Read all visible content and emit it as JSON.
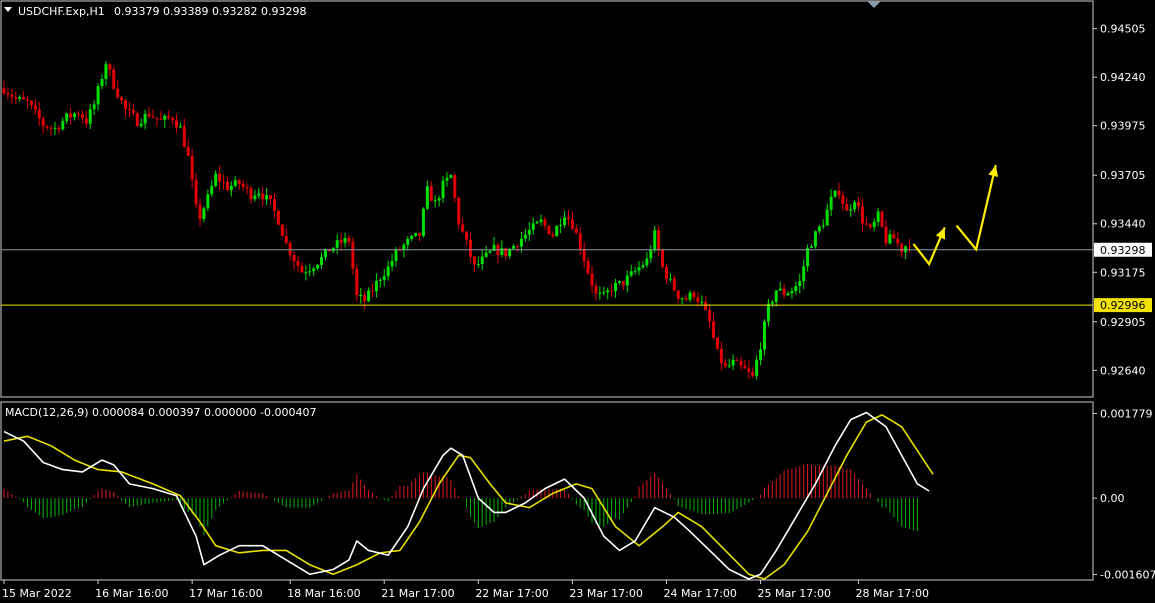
{
  "chart_data": [
    {
      "type": "candlestick",
      "symbol_header": "USDCHF.Exp,H1",
      "ohlc_header": "0.93379 0.93389 0.93282 0.93298",
      "price_ticks": [
        "0.94505",
        "0.94240",
        "0.93975",
        "0.93705",
        "0.93440",
        "0.93175",
        "0.92905",
        "0.92640"
      ],
      "ylim": [
        0.925,
        0.9465
      ],
      "current_price": "0.93298",
      "level_line": "0.92996",
      "colors": {
        "bull": "#00e000",
        "bear": "#e00000",
        "level": "#f2e400",
        "current_line": "#8c9aa8",
        "arrow": "#ffee00"
      },
      "x_ticks": [
        "15 Mar 2022",
        "16 Mar 16:00",
        "17 Mar 16:00",
        "18 Mar 16:00",
        "21 Mar 17:00",
        "22 Mar 17:00",
        "23 Mar 17:00",
        "24 Mar 17:00",
        "25 Mar 17:00",
        "28 Mar 17:00"
      ],
      "close_path": [
        [
          0,
          0.9418
        ],
        [
          3,
          0.9412
        ],
        [
          6,
          0.941
        ],
        [
          10,
          0.9398
        ],
        [
          13,
          0.9396
        ],
        [
          16,
          0.9402
        ],
        [
          19,
          0.9405
        ],
        [
          21,
          0.94
        ],
        [
          23,
          0.9409
        ],
        [
          26,
          0.9432
        ],
        [
          28,
          0.942
        ],
        [
          31,
          0.9406
        ],
        [
          34,
          0.94
        ],
        [
          37,
          0.9404
        ],
        [
          40,
          0.94
        ],
        [
          43,
          0.9402
        ],
        [
          45,
          0.9396
        ],
        [
          47,
          0.938
        ],
        [
          49,
          0.9352
        ],
        [
          50,
          0.9348
        ],
        [
          52,
          0.9358
        ],
        [
          54,
          0.937
        ],
        [
          57,
          0.9364
        ],
        [
          60,
          0.9366
        ],
        [
          63,
          0.936
        ],
        [
          65,
          0.9362
        ],
        [
          68,
          0.9355
        ],
        [
          70,
          0.9346
        ],
        [
          72,
          0.9333
        ],
        [
          74,
          0.9325
        ],
        [
          76,
          0.9318
        ],
        [
          78,
          0.932
        ],
        [
          81,
          0.9325
        ],
        [
          83,
          0.933
        ],
        [
          86,
          0.9334
        ],
        [
          88,
          0.9335
        ],
        [
          90,
          0.9304
        ],
        [
          92,
          0.9302
        ],
        [
          94,
          0.9308
        ],
        [
          96,
          0.9315
        ],
        [
          98,
          0.932
        ],
        [
          100,
          0.9328
        ],
        [
          103,
          0.9334
        ],
        [
          106,
          0.9338
        ],
        [
          108,
          0.9362
        ],
        [
          110,
          0.9355
        ],
        [
          112,
          0.9365
        ],
        [
          114,
          0.937
        ],
        [
          116,
          0.9345
        ],
        [
          118,
          0.9333
        ],
        [
          120,
          0.932
        ],
        [
          122,
          0.9324
        ],
        [
          125,
          0.933
        ],
        [
          128,
          0.9328
        ],
        [
          131,
          0.9334
        ],
        [
          134,
          0.934
        ],
        [
          137,
          0.9345
        ],
        [
          140,
          0.9338
        ],
        [
          143,
          0.935
        ],
        [
          145,
          0.9344
        ],
        [
          147,
          0.9332
        ],
        [
          149,
          0.9318
        ],
        [
          151,
          0.9305
        ],
        [
          153,
          0.9304
        ],
        [
          155,
          0.9309
        ],
        [
          158,
          0.9312
        ],
        [
          161,
          0.9318
        ],
        [
          164,
          0.9324
        ],
        [
          166,
          0.9338
        ],
        [
          168,
          0.932
        ],
        [
          170,
          0.9312
        ],
        [
          172,
          0.9305
        ],
        [
          174,
          0.9303
        ],
        [
          176,
          0.9306
        ],
        [
          178,
          0.93
        ],
        [
          180,
          0.929
        ],
        [
          182,
          0.9273
        ],
        [
          184,
          0.9265
        ],
        [
          186,
          0.9268
        ],
        [
          189,
          0.9264
        ],
        [
          191,
          0.926
        ],
        [
          193,
          0.9278
        ],
        [
          195,
          0.9298
        ],
        [
          197,
          0.9308
        ],
        [
          199,
          0.9306
        ],
        [
          201,
          0.9308
        ],
        [
          203,
          0.9312
        ],
        [
          205,
          0.933
        ],
        [
          207,
          0.9338
        ],
        [
          209,
          0.9345
        ],
        [
          211,
          0.9357
        ],
        [
          213,
          0.9362
        ],
        [
          215,
          0.935
        ],
        [
          217,
          0.9358
        ],
        [
          219,
          0.9346
        ],
        [
          221,
          0.934
        ],
        [
          223,
          0.9348
        ],
        [
          225,
          0.9335
        ],
        [
          227,
          0.9336
        ],
        [
          229,
          0.933
        ],
        [
          231,
          0.9334
        ]
      ],
      "arrows": [
        [
          [
            232,
            0.9333
          ],
          [
            236,
            0.9322
          ],
          [
            240,
            0.9342
          ]
        ],
        [
          [
            243,
            0.9343
          ],
          [
            248,
            0.933
          ],
          [
            253,
            0.9376
          ]
        ]
      ]
    },
    {
      "type": "macd",
      "title": "MACD(12,26,9) 0.000084 0.000397 0.000000 -0.000407",
      "ticks": [
        "0.001779",
        "0.00",
        "-0.001607"
      ],
      "ylim": [
        -0.0017,
        0.002
      ],
      "colors": {
        "pos": "#e01818",
        "neg": "#00b800",
        "macd": "#ffffff",
        "signal": "#e8e000"
      },
      "macd": [
        [
          0,
          0.0014
        ],
        [
          5,
          0.0012
        ],
        [
          10,
          0.00075
        ],
        [
          15,
          0.0006
        ],
        [
          20,
          0.00055
        ],
        [
          25,
          0.0008
        ],
        [
          28,
          0.0007
        ],
        [
          32,
          0.0003
        ],
        [
          38,
          0.0002
        ],
        [
          44,
          5e-05
        ],
        [
          49,
          -0.0008
        ],
        [
          51,
          -0.0014
        ],
        [
          55,
          -0.0012
        ],
        [
          60,
          -0.001
        ],
        [
          66,
          -0.001
        ],
        [
          72,
          -0.0013
        ],
        [
          78,
          -0.0016
        ],
        [
          84,
          -0.0015
        ],
        [
          88,
          -0.0013
        ],
        [
          90,
          -0.0009
        ],
        [
          93,
          -0.0011
        ],
        [
          98,
          -0.0012
        ],
        [
          103,
          -0.0006
        ],
        [
          107,
          0.0002
        ],
        [
          112,
          0.0009
        ],
        [
          114,
          0.00105
        ],
        [
          117,
          0.0009
        ],
        [
          121,
          0.0
        ],
        [
          125,
          -0.0003
        ],
        [
          128,
          -0.0003
        ],
        [
          133,
          -0.0001
        ],
        [
          138,
          0.0002
        ],
        [
          143,
          0.0004
        ],
        [
          148,
          0.0
        ],
        [
          153,
          -0.0008
        ],
        [
          157,
          -0.0011
        ],
        [
          161,
          -0.0009
        ],
        [
          166,
          -0.0002
        ],
        [
          171,
          -0.0004
        ],
        [
          175,
          -0.0007
        ],
        [
          180,
          -0.0011
        ],
        [
          185,
          -0.0015
        ],
        [
          190,
          -0.0017
        ],
        [
          193,
          -0.0016
        ],
        [
          197,
          -0.0011
        ],
        [
          202,
          -0.0004
        ],
        [
          207,
          0.0003
        ],
        [
          212,
          0.0011
        ],
        [
          216,
          0.00165
        ],
        [
          220,
          0.0018
        ],
        [
          225,
          0.0015
        ],
        [
          229,
          0.0009
        ],
        [
          233,
          0.0003
        ],
        [
          236,
          0.00015
        ]
      ],
      "signal": [
        [
          0,
          0.0012
        ],
        [
          6,
          0.0013
        ],
        [
          12,
          0.0011
        ],
        [
          18,
          0.0008
        ],
        [
          24,
          0.0006
        ],
        [
          30,
          0.00055
        ],
        [
          38,
          0.0003
        ],
        [
          45,
          5e-05
        ],
        [
          50,
          -0.0005
        ],
        [
          54,
          -0.001
        ],
        [
          60,
          -0.00115
        ],
        [
          66,
          -0.0011
        ],
        [
          72,
          -0.0011
        ],
        [
          78,
          -0.0014
        ],
        [
          84,
          -0.0016
        ],
        [
          90,
          -0.0014
        ],
        [
          96,
          -0.00115
        ],
        [
          101,
          -0.0011
        ],
        [
          106,
          -0.0005
        ],
        [
          111,
          0.0003
        ],
        [
          116,
          0.0009
        ],
        [
          119,
          0.00085
        ],
        [
          124,
          0.0003
        ],
        [
          128,
          -0.0001
        ],
        [
          134,
          -0.0002
        ],
        [
          140,
          0.0001
        ],
        [
          146,
          0.0003
        ],
        [
          150,
          0.0002
        ],
        [
          156,
          -0.0006
        ],
        [
          162,
          -0.001
        ],
        [
          168,
          -0.0006
        ],
        [
          172,
          -0.0003
        ],
        [
          178,
          -0.0006
        ],
        [
          184,
          -0.0011
        ],
        [
          190,
          -0.0016
        ],
        [
          194,
          -0.0017
        ],
        [
          199,
          -0.0014
        ],
        [
          205,
          -0.0007
        ],
        [
          210,
          0.0001
        ],
        [
          215,
          0.0009
        ],
        [
          220,
          0.0016
        ],
        [
          224,
          0.00175
        ],
        [
          229,
          0.0015
        ],
        [
          233,
          0.001
        ],
        [
          237,
          0.0005
        ]
      ]
    }
  ]
}
